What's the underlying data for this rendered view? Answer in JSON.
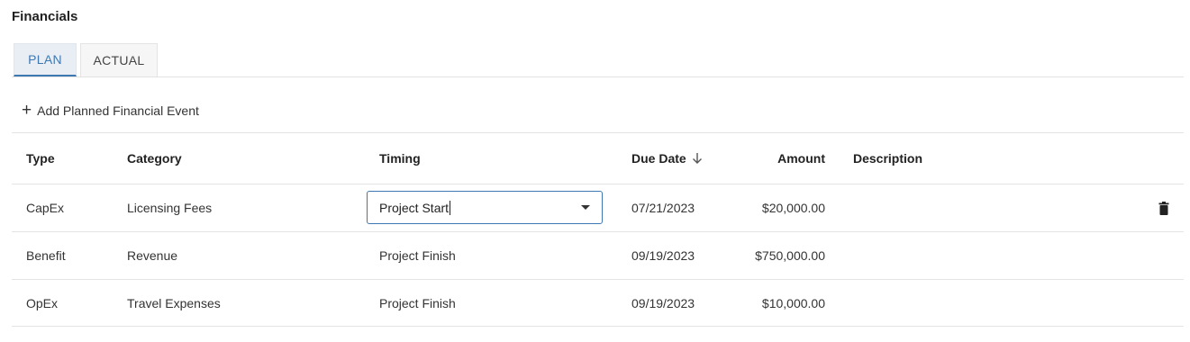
{
  "section": {
    "title": "Financials"
  },
  "tabs": [
    {
      "label": "PLAN",
      "active": true
    },
    {
      "label": "ACTUAL",
      "active": false
    }
  ],
  "add_button": {
    "icon": "plus-icon",
    "label": "Add Planned Financial Event"
  },
  "table": {
    "columns": {
      "type": "Type",
      "category": "Category",
      "timing": "Timing",
      "due_date": "Due Date",
      "amount": "Amount",
      "description": "Description"
    },
    "sort": {
      "column": "due_date",
      "direction": "descending",
      "icon": "arrow-down-icon"
    },
    "rows": [
      {
        "type": "CapEx",
        "category": "Licensing Fees",
        "timing": "Project Start",
        "timing_editing": true,
        "due_date": "07/21/2023",
        "amount": "$20,000.00",
        "description": "",
        "action_icon": "trash-icon"
      },
      {
        "type": "Benefit",
        "category": "Revenue",
        "timing": "Project Finish",
        "due_date": "09/19/2023",
        "amount": "$750,000.00",
        "description": ""
      },
      {
        "type": "OpEx",
        "category": "Travel Expenses",
        "timing": "Project Finish",
        "due_date": "09/19/2023",
        "amount": "$10,000.00",
        "description": ""
      }
    ]
  },
  "colors": {
    "accent": "#3e78b2",
    "tab_active_bg": "#e8eef4",
    "border": "#e4e4e4"
  }
}
